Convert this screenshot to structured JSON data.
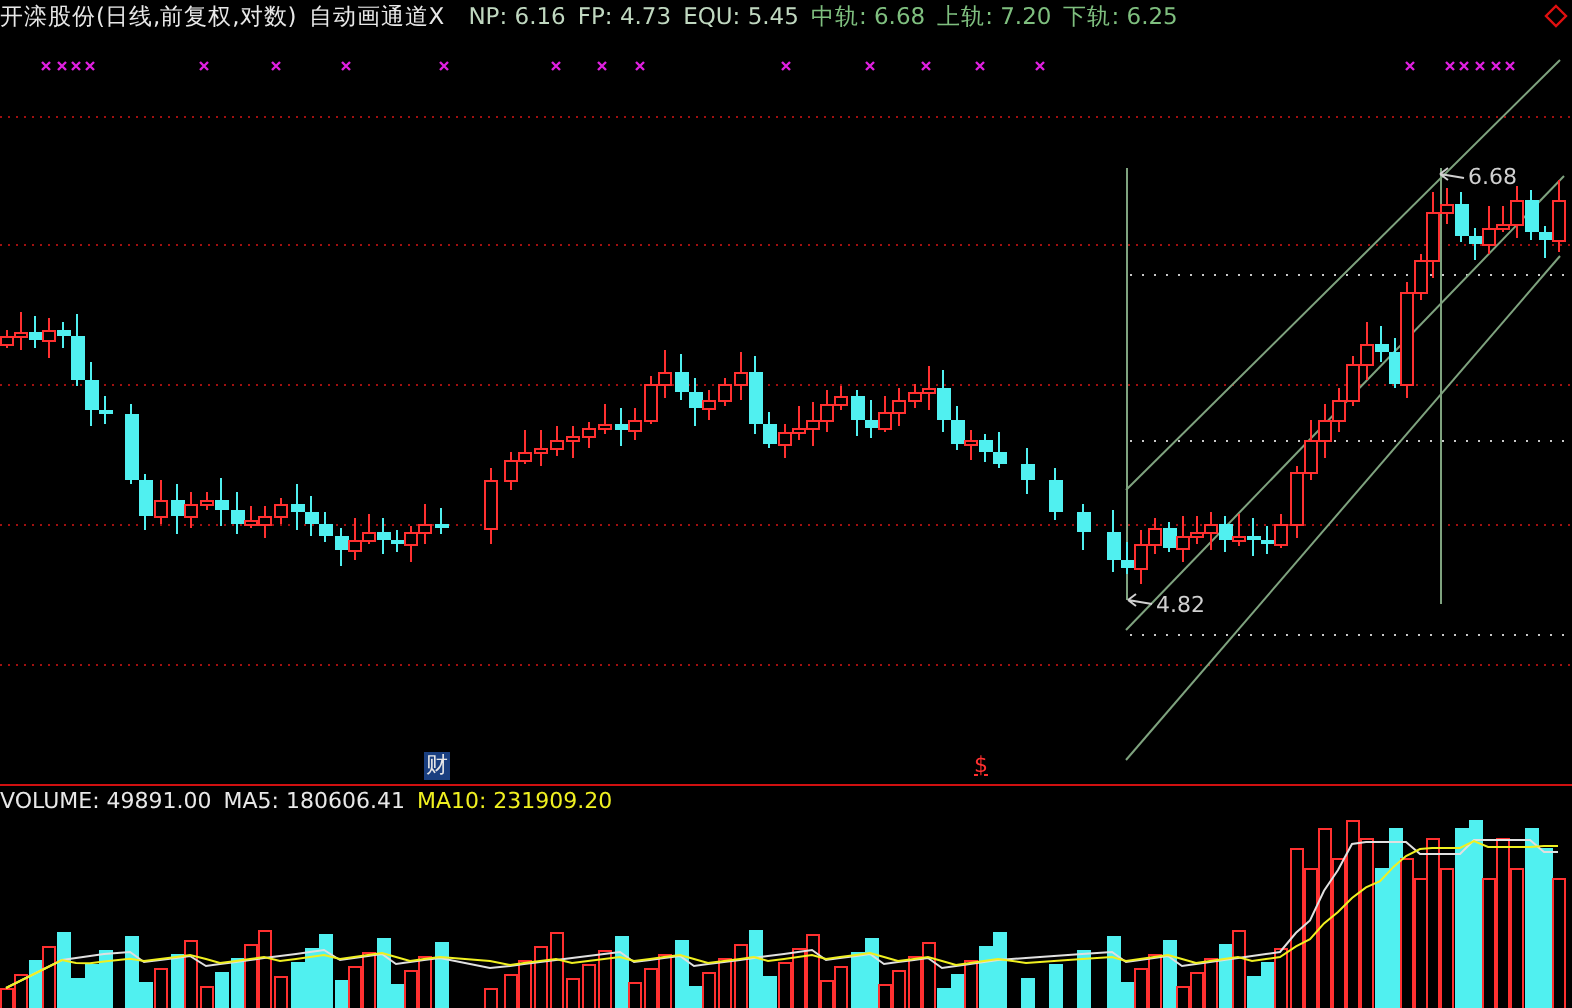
{
  "header": {
    "title": "开滦股份(日线,前复权,对数)",
    "indicator": "自动画通道X",
    "readouts": [
      {
        "label": "NP:",
        "value": "6.16",
        "kind": "price"
      },
      {
        "label": "FP:",
        "value": "4.73",
        "kind": "price"
      },
      {
        "label": "EQU:",
        "value": "5.45",
        "kind": "price"
      },
      {
        "label": "中轨:",
        "value": "6.68",
        "kind": "channel"
      },
      {
        "label": "上轨:",
        "value": "7.20",
        "kind": "channel"
      },
      {
        "label": "下轨:",
        "value": "6.25",
        "kind": "channel"
      }
    ]
  },
  "price_chart": {
    "high_label": "6.68",
    "low_label": "4.82",
    "event_markers": [
      {
        "text": "财",
        "kind": "finance"
      },
      {
        "text": "$",
        "kind": "dividend"
      }
    ]
  },
  "volume": {
    "readouts": [
      {
        "label": "VOLUME:",
        "value": "49891.00",
        "kind": "volume"
      },
      {
        "label": "MA5:",
        "value": "180606.41",
        "kind": "ma5"
      },
      {
        "label": "MA10:",
        "value": "231909.20",
        "kind": "ma10"
      }
    ]
  }
}
